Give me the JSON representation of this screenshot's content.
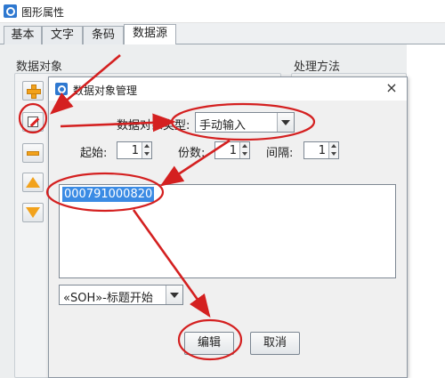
{
  "window": {
    "title": "图形属性",
    "icon": "app-logo-icon"
  },
  "tabs": [
    {
      "label": "基本",
      "active": false
    },
    {
      "label": "文字",
      "active": false
    },
    {
      "label": "条码",
      "active": false
    },
    {
      "label": "数据源",
      "active": true
    }
  ],
  "panel": {
    "data_objects_label": "数据对象",
    "process_method_label": "处理方法",
    "side_buttons": [
      "plus-icon",
      "edit-icon",
      "minus-icon",
      "arrow-up-icon",
      "arrow-down-icon"
    ]
  },
  "dialog": {
    "title": "数据对象管理",
    "close": "×",
    "type_label": "数据对象类型:",
    "type_value": "手动输入",
    "start_label": "起始:",
    "start_value": "1",
    "copies_label": "份数:",
    "copies_value": "1",
    "interval_label": "间隔:",
    "interval_value": "1",
    "data_value": "000791000820",
    "special_char": "«SOH»-标题开始",
    "edit_button": "编辑",
    "cancel_button": "取消"
  },
  "colors": {
    "annotation": "#d42020",
    "selection": "#3b8be4",
    "accent": "#f2a21c"
  }
}
